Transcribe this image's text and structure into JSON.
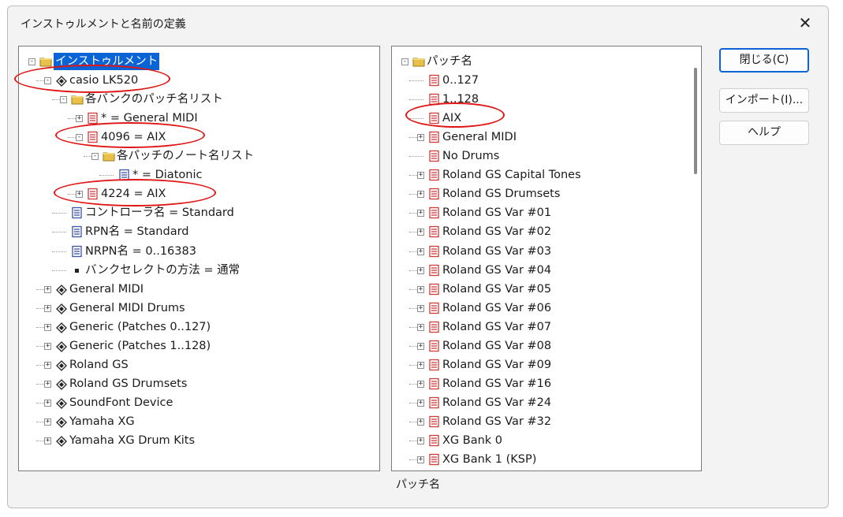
{
  "dialog": {
    "title": "インストゥルメントと名前の定義",
    "close_label": "✕",
    "status_text": "パッチ名"
  },
  "buttons": {
    "close": "閉じる(C)",
    "import": "インポート(I)...",
    "help": "ヘルプ"
  },
  "left_tree": [
    {
      "label": "インストゥルメント",
      "level": 0,
      "icon": "folder-icon",
      "toggle": "-",
      "selected": true
    },
    {
      "label": "casio LK520",
      "level": 1,
      "icon": "instrument-icon",
      "toggle": "-"
    },
    {
      "label": "各バンクのパッチ名リスト",
      "level": 2,
      "icon": "folder-icon",
      "toggle": "-"
    },
    {
      "label": "* = General MIDI",
      "level": 3,
      "icon": "bank-icon",
      "toggle": "+"
    },
    {
      "label": "4096 = AIX",
      "level": 3,
      "icon": "bank-icon",
      "toggle": "-"
    },
    {
      "label": "各パッチのノート名リスト",
      "level": 4,
      "icon": "folder-icon",
      "toggle": "-"
    },
    {
      "label": "* = Diatonic",
      "level": 5,
      "icon": "note-list-icon",
      "toggle": ""
    },
    {
      "label": "4224 = AIX",
      "level": 3,
      "icon": "bank-icon",
      "toggle": "+"
    },
    {
      "label": "コントローラ名 = Standard",
      "level": 2,
      "icon": "controller-icon",
      "toggle": ""
    },
    {
      "label": "RPN名 = Standard",
      "level": 2,
      "icon": "controller-icon",
      "toggle": ""
    },
    {
      "label": "NRPN名 = 0..16383",
      "level": 2,
      "icon": "controller-icon",
      "toggle": ""
    },
    {
      "label": "バンクセレクトの方法 = 通常",
      "level": 2,
      "icon": "bullet-icon",
      "toggle": ""
    },
    {
      "label": "General MIDI",
      "level": 1,
      "icon": "instrument-icon",
      "toggle": "+"
    },
    {
      "label": "General MIDI Drums",
      "level": 1,
      "icon": "instrument-icon",
      "toggle": "+"
    },
    {
      "label": "Generic (Patches 0..127)",
      "level": 1,
      "icon": "instrument-icon",
      "toggle": "+"
    },
    {
      "label": "Generic (Patches 1..128)",
      "level": 1,
      "icon": "instrument-icon",
      "toggle": "+"
    },
    {
      "label": "Roland GS",
      "level": 1,
      "icon": "instrument-icon",
      "toggle": "+"
    },
    {
      "label": "Roland GS Drumsets",
      "level": 1,
      "icon": "instrument-icon",
      "toggle": "+"
    },
    {
      "label": "SoundFont Device",
      "level": 1,
      "icon": "instrument-icon",
      "toggle": "+"
    },
    {
      "label": "Yamaha XG",
      "level": 1,
      "icon": "instrument-icon",
      "toggle": "+"
    },
    {
      "label": "Yamaha XG Drum Kits",
      "level": 1,
      "icon": "instrument-icon",
      "toggle": "+"
    }
  ],
  "right_tree": [
    {
      "label": "パッチ名",
      "level": 0,
      "icon": "folder-icon",
      "toggle": "-"
    },
    {
      "label": "0..127",
      "level": 1,
      "icon": "patch-list-icon",
      "toggle": ""
    },
    {
      "label": "1..128",
      "level": 1,
      "icon": "patch-list-icon",
      "toggle": ""
    },
    {
      "label": "AIX",
      "level": 1,
      "icon": "patch-list-icon",
      "toggle": ""
    },
    {
      "label": "General MIDI",
      "level": 1,
      "icon": "patch-list-icon",
      "toggle": "+"
    },
    {
      "label": "No Drums",
      "level": 1,
      "icon": "patch-list-icon",
      "toggle": ""
    },
    {
      "label": "Roland GS Capital Tones",
      "level": 1,
      "icon": "patch-list-icon",
      "toggle": "+"
    },
    {
      "label": "Roland GS Drumsets",
      "level": 1,
      "icon": "patch-list-icon",
      "toggle": "+"
    },
    {
      "label": "Roland GS Var #01",
      "level": 1,
      "icon": "patch-list-icon",
      "toggle": "+"
    },
    {
      "label": "Roland GS Var #02",
      "level": 1,
      "icon": "patch-list-icon",
      "toggle": "+"
    },
    {
      "label": "Roland GS Var #03",
      "level": 1,
      "icon": "patch-list-icon",
      "toggle": "+"
    },
    {
      "label": "Roland GS Var #04",
      "level": 1,
      "icon": "patch-list-icon",
      "toggle": "+"
    },
    {
      "label": "Roland GS Var #05",
      "level": 1,
      "icon": "patch-list-icon",
      "toggle": "+"
    },
    {
      "label": "Roland GS Var #06",
      "level": 1,
      "icon": "patch-list-icon",
      "toggle": "+"
    },
    {
      "label": "Roland GS Var #07",
      "level": 1,
      "icon": "patch-list-icon",
      "toggle": "+"
    },
    {
      "label": "Roland GS Var #08",
      "level": 1,
      "icon": "patch-list-icon",
      "toggle": "+"
    },
    {
      "label": "Roland GS Var #09",
      "level": 1,
      "icon": "patch-list-icon",
      "toggle": "+"
    },
    {
      "label": "Roland GS Var #16",
      "level": 1,
      "icon": "patch-list-icon",
      "toggle": "+"
    },
    {
      "label": "Roland GS Var #24",
      "level": 1,
      "icon": "patch-list-icon",
      "toggle": "+"
    },
    {
      "label": "Roland GS Var #32",
      "level": 1,
      "icon": "patch-list-icon",
      "toggle": "+"
    },
    {
      "label": "XG Bank 0",
      "level": 1,
      "icon": "patch-list-icon",
      "toggle": "+"
    },
    {
      "label": "XG Bank 1 (KSP)",
      "level": 1,
      "icon": "patch-list-icon",
      "toggle": "+"
    }
  ],
  "colors": {
    "selection": "#0a64d6",
    "annotation_ring": "#e01616",
    "folder": "#e8c04a",
    "patch_icon": "#d23a3a"
  }
}
